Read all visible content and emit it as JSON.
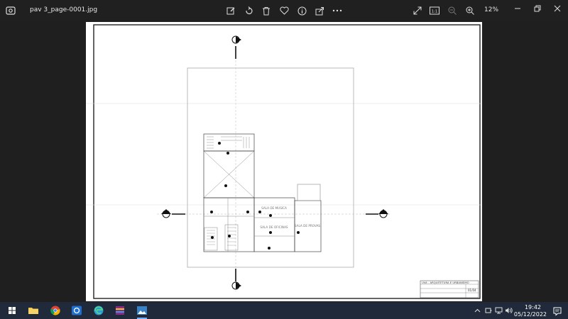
{
  "window": {
    "file_name": "pav 3_page-0001.jpg",
    "zoom": "12%",
    "actual_size_label": "1:1"
  },
  "toolbar": {
    "icons": [
      "edit-icon",
      "rotate-icon",
      "delete-icon",
      "favorite-icon",
      "info-icon",
      "share-icon",
      "more-icon",
      "expand-icon",
      "actual-size-icon",
      "zoom-out-icon",
      "zoom-in-icon"
    ]
  },
  "drawing": {
    "rooms": {
      "sala_musica": "SALA DE MUSICA",
      "sala_oficinas": "SALA DE OFICINAS",
      "sala_provas": "SALA DE PROVAS"
    },
    "title_block": {
      "institution": "UVA - ARQUITETURA E URBANISMO",
      "sheet": "01/04"
    }
  },
  "taskbar": {
    "apps": [
      "windows-start",
      "file-explorer",
      "chrome",
      "app-blue",
      "edge",
      "winrar",
      "photos"
    ],
    "time": "19:42",
    "date": "05/12/2022"
  }
}
